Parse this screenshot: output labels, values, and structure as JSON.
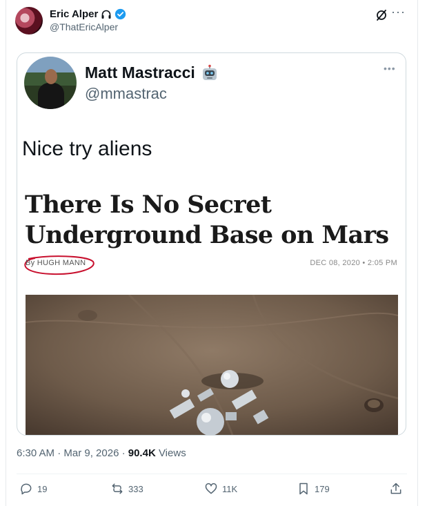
{
  "author": {
    "name": "Eric Alper",
    "handle": "@ThatEricAlper"
  },
  "quoted": {
    "name": "Matt Mastracci",
    "handle": "@mmastrac",
    "text": "Nice try aliens",
    "article": {
      "headline": "There Is No Secret Underground Base on Mars",
      "byline": "By HUGH MANN",
      "date": "DEC 08, 2020 • 2:05 PM"
    }
  },
  "meta": {
    "time": "6:30 AM · Mar 9, 2026 · ",
    "views_count": "90.4K",
    "views_label": " Views"
  },
  "actions": {
    "replies": "19",
    "reposts": "333",
    "likes": "11K",
    "bookmarks": "179"
  },
  "colors": {
    "verified": "#1d9bf0",
    "text_secondary": "#536471",
    "circle_annotation": "#c8102e"
  },
  "icons": [
    "headphones-icon",
    "verified-badge-icon",
    "grok-icon",
    "more-icon",
    "robot-emoji-icon",
    "reply-icon",
    "repost-icon",
    "like-icon",
    "bookmark-icon",
    "share-icon"
  ]
}
